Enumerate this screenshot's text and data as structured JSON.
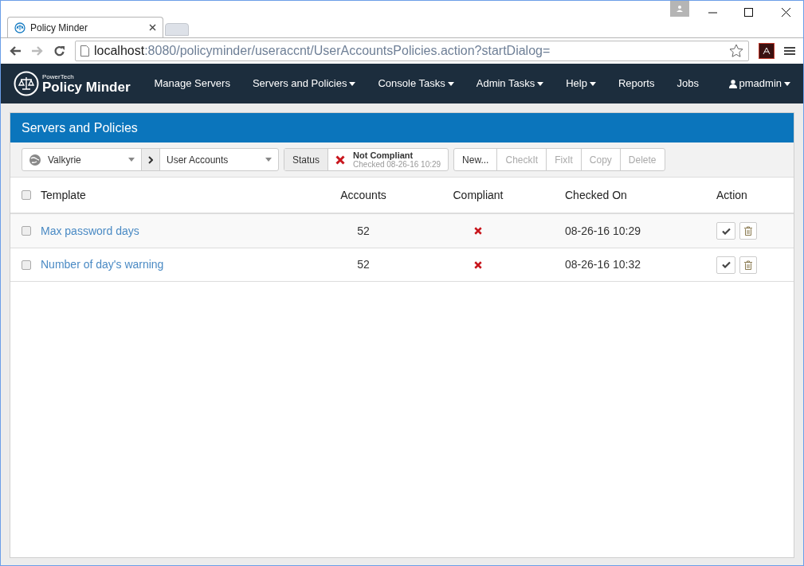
{
  "browser": {
    "tab_title": "Policy Minder",
    "url_host": "localhost",
    "url_rest": ":8080/policyminder/useraccnt/UserAccountsPolicies.action?startDialog="
  },
  "navbar": {
    "brand_small": "PowerTech",
    "brand": "Policy Minder",
    "items": [
      {
        "label": "Manage Servers",
        "dropdown": false
      },
      {
        "label": "Servers and Policies",
        "dropdown": true
      },
      {
        "label": "Console Tasks",
        "dropdown": true
      },
      {
        "label": "Admin Tasks",
        "dropdown": true
      },
      {
        "label": "Help",
        "dropdown": true
      },
      {
        "label": "Reports",
        "dropdown": false
      },
      {
        "label": "Jobs",
        "dropdown": false
      }
    ],
    "user": "pmadmin"
  },
  "panel": {
    "title": "Servers and Policies",
    "server_select": "Valkyrie",
    "category_select": "User Accounts",
    "status": {
      "label": "Status",
      "value": "Not Compliant",
      "checked": "Checked 08-26-16 10:29",
      "compliant": false
    },
    "buttons": [
      {
        "label": "New...",
        "disabled": false
      },
      {
        "label": "CheckIt",
        "disabled": true
      },
      {
        "label": "FixIt",
        "disabled": true
      },
      {
        "label": "Copy",
        "disabled": true
      },
      {
        "label": "Delete",
        "disabled": true
      }
    ],
    "table": {
      "select_all": false,
      "columns": [
        "Template",
        "Accounts",
        "Compliant",
        "Checked On",
        "Action"
      ],
      "rows": [
        {
          "checked": false,
          "template": "Max password days",
          "accounts": "52",
          "compliant": false,
          "checked_on": "08-26-16 10:29"
        },
        {
          "checked": false,
          "template": "Number of day's warning",
          "accounts": "52",
          "compliant": false,
          "checked_on": "08-26-16 10:32"
        }
      ]
    }
  }
}
